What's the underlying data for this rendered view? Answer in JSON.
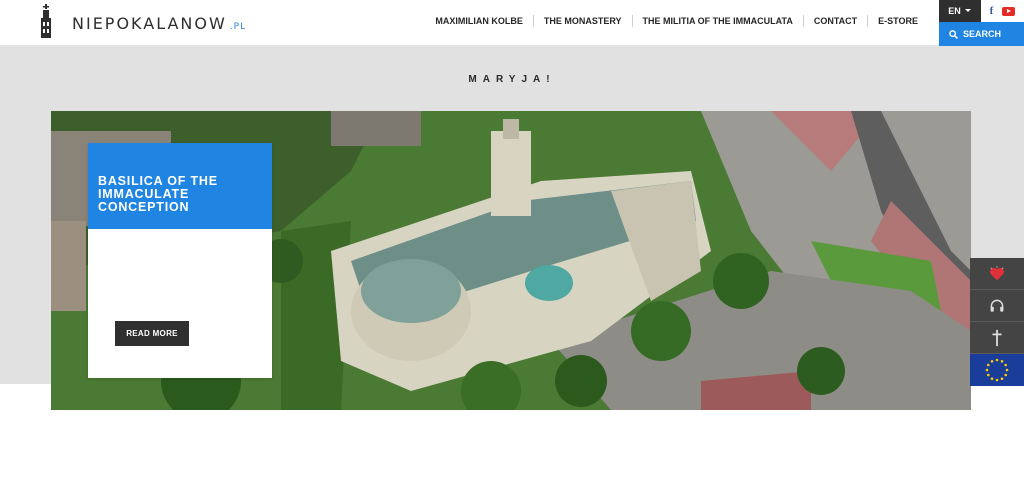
{
  "header": {
    "logo_text": "NIEPOKALANOW",
    "logo_suffix": ".PL",
    "nav": [
      "MAXIMILIAN KOLBE",
      "THE MONASTERY",
      "THE MILITIA OF THE IMMACULATA",
      "CONTACT",
      "E-STORE"
    ],
    "lang_label": "EN",
    "search_label": "SEARCH"
  },
  "tagline": "MARYJA!",
  "hero": {
    "card_title": "BASILICA OF THE IMMACULATE CONCEPTION",
    "read_more_label": "READ MORE"
  },
  "side_widgets": [
    "heart-icon",
    "headphones-icon",
    "cross-icon",
    "eu-flag-icon"
  ],
  "colors": {
    "accent": "#1f84e2",
    "dark_button": "#303030",
    "band": "#e1e1e1",
    "eu_blue": "#1b3d9a"
  }
}
